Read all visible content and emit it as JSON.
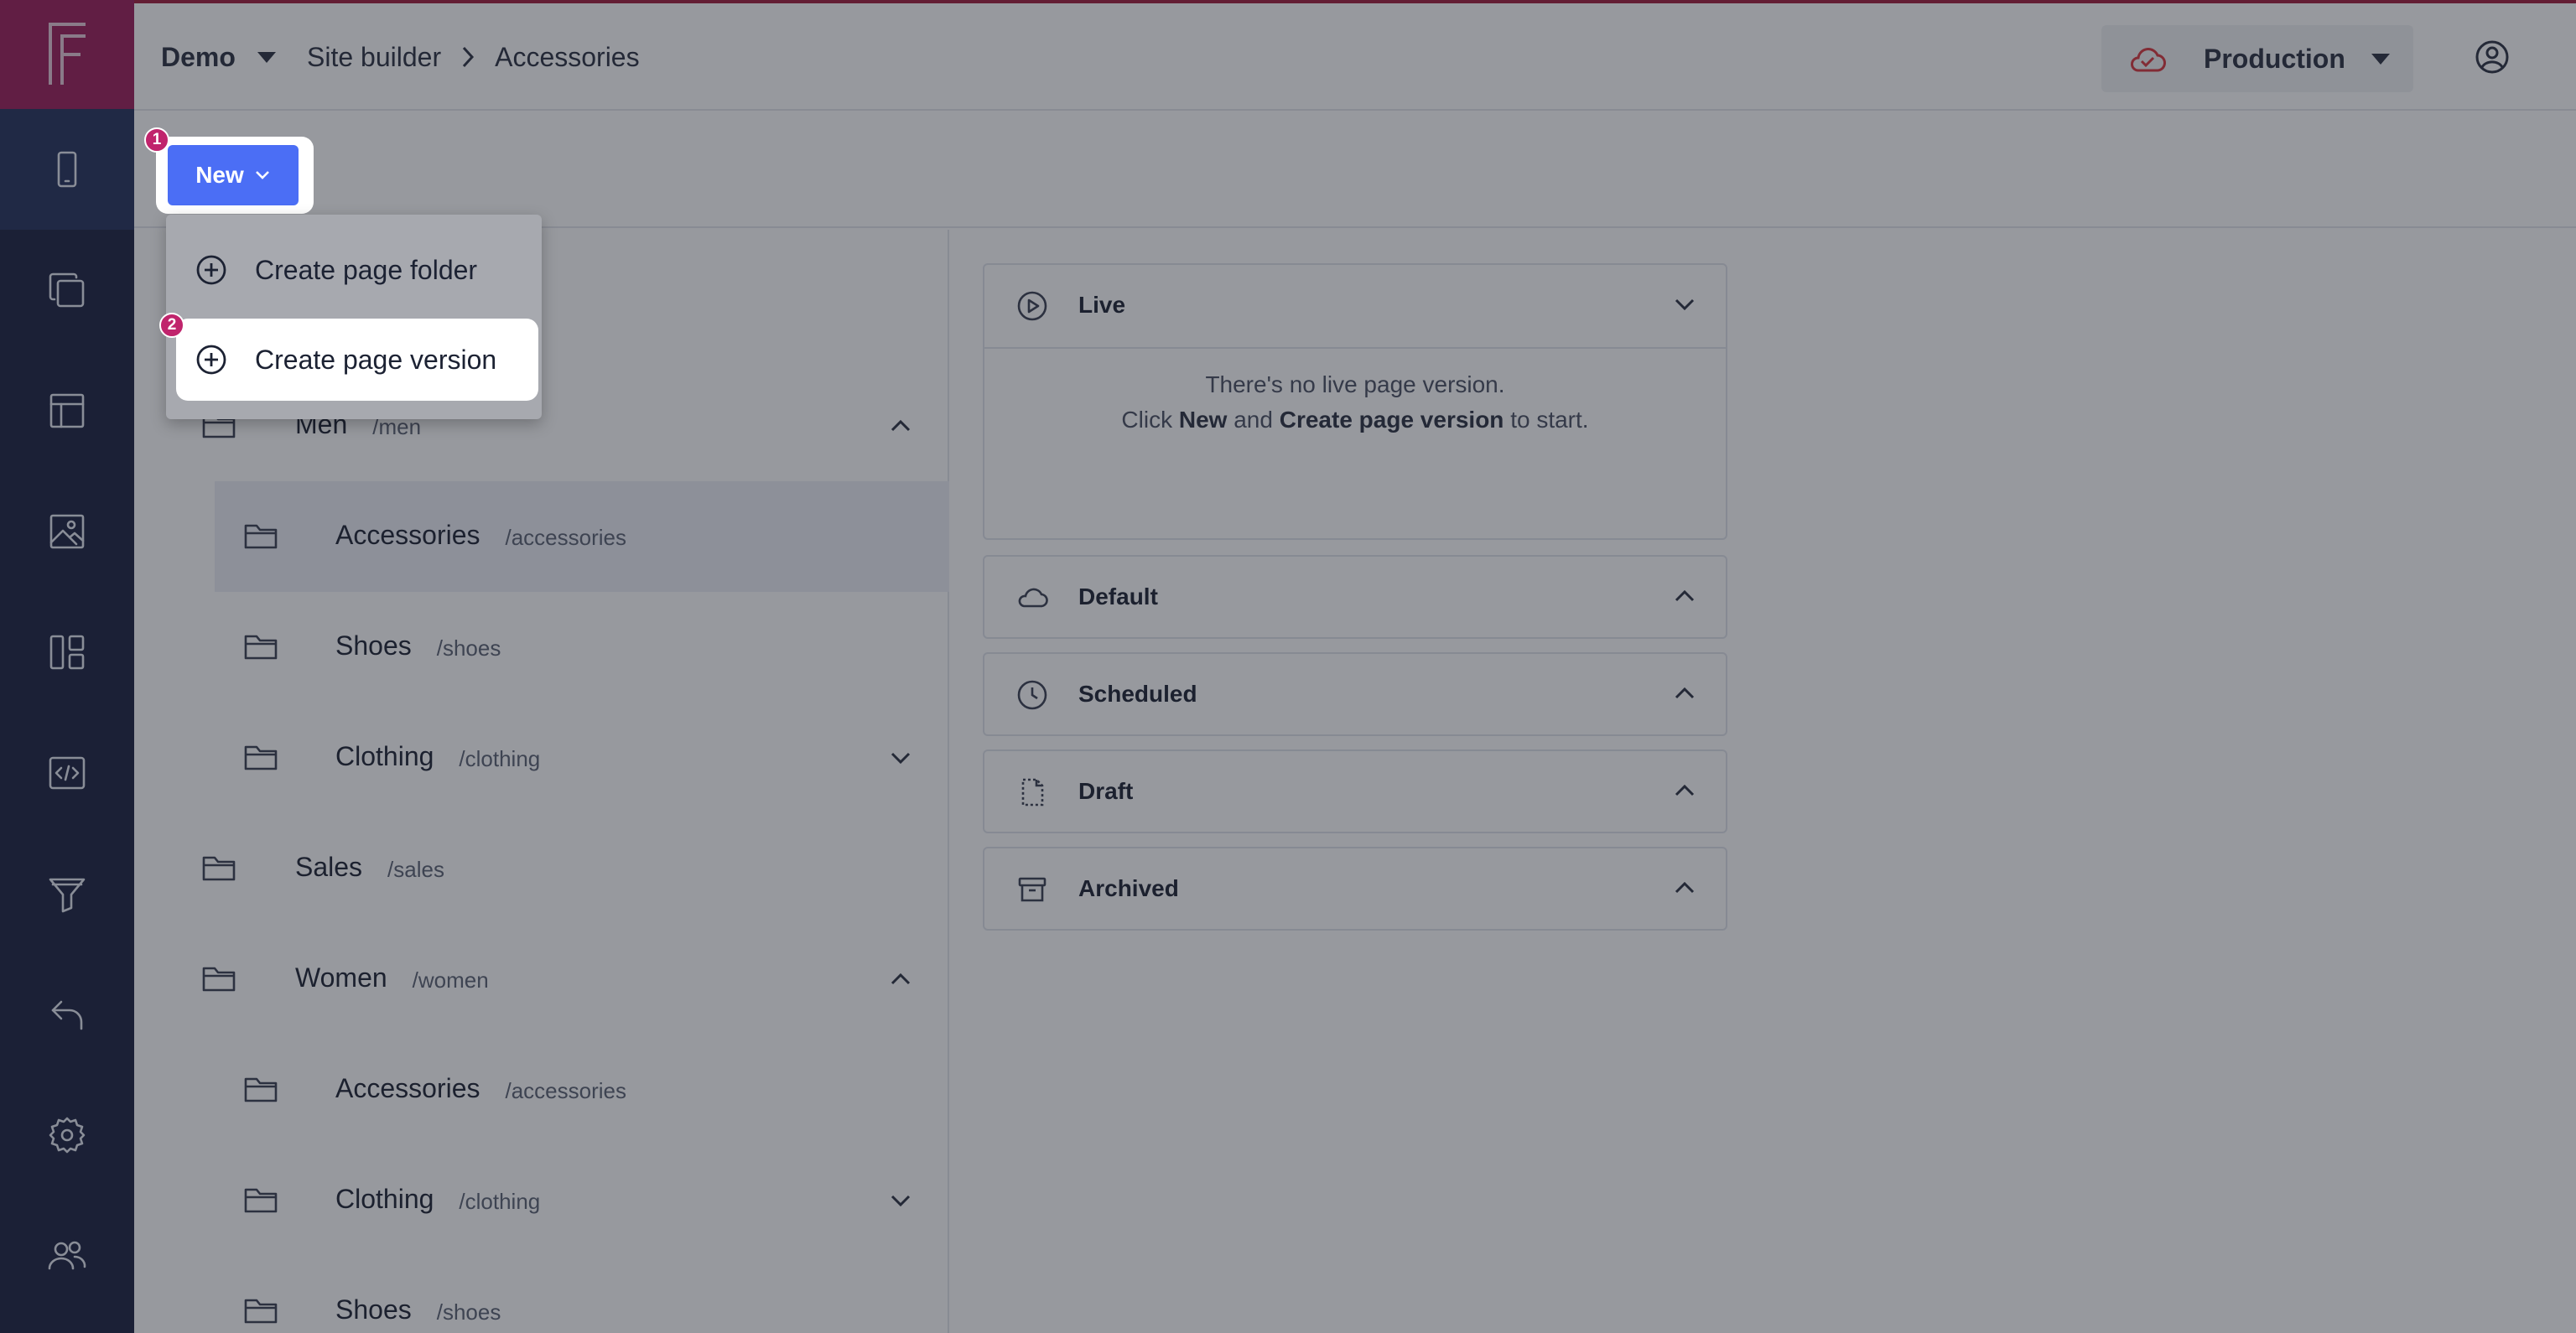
{
  "app": {
    "logo_letter": "F"
  },
  "sidebar": {
    "items": [
      {
        "name": "mobile-icon",
        "active": true
      },
      {
        "name": "copy-pages-icon"
      },
      {
        "name": "layout-icon"
      },
      {
        "name": "image-icon"
      },
      {
        "name": "components-icon"
      },
      {
        "name": "code-icon"
      },
      {
        "name": "funnel-icon"
      },
      {
        "name": "undo-icon"
      },
      {
        "name": "gear-icon"
      },
      {
        "name": "users-icon"
      }
    ]
  },
  "header": {
    "project": "Demo",
    "breadcrumb": [
      "Site builder",
      "Accessories"
    ],
    "environment": "Production"
  },
  "toolbar": {
    "new_label": "New"
  },
  "dropdown": {
    "items": [
      {
        "label": "Create page folder"
      },
      {
        "label": "Create page version"
      }
    ]
  },
  "tour": {
    "badges": [
      "1",
      "2"
    ]
  },
  "tree": {
    "rows": [
      {
        "label": "Men",
        "path": "/men",
        "depth": 1,
        "chevron": "up"
      },
      {
        "label": "Accessories",
        "path": "/accessories",
        "depth": 2,
        "selected": true
      },
      {
        "label": "Shoes",
        "path": "/shoes",
        "depth": 2
      },
      {
        "label": "Clothing",
        "path": "/clothing",
        "depth": 2,
        "chevron": "down"
      },
      {
        "label": "Sales",
        "path": "/sales",
        "depth": 1
      },
      {
        "label": "Women",
        "path": "/women",
        "depth": 1,
        "chevron": "up"
      },
      {
        "label": "Accessories",
        "path": "/accessories",
        "depth": 2
      },
      {
        "label": "Clothing",
        "path": "/clothing",
        "depth": 2,
        "chevron": "down"
      },
      {
        "label": "Shoes",
        "path": "/shoes",
        "depth": 2
      }
    ]
  },
  "versions": {
    "live": {
      "title": "Live",
      "empty_line1": "There's no live page version.",
      "empty_click": "Click",
      "empty_new": "New",
      "empty_and": "and",
      "empty_create": "Create page version",
      "empty_tail": "to start."
    },
    "default": {
      "title": "Default"
    },
    "scheduled": {
      "title": "Scheduled"
    },
    "draft": {
      "title": "Draft"
    },
    "archived": {
      "title": "Archived"
    }
  }
}
